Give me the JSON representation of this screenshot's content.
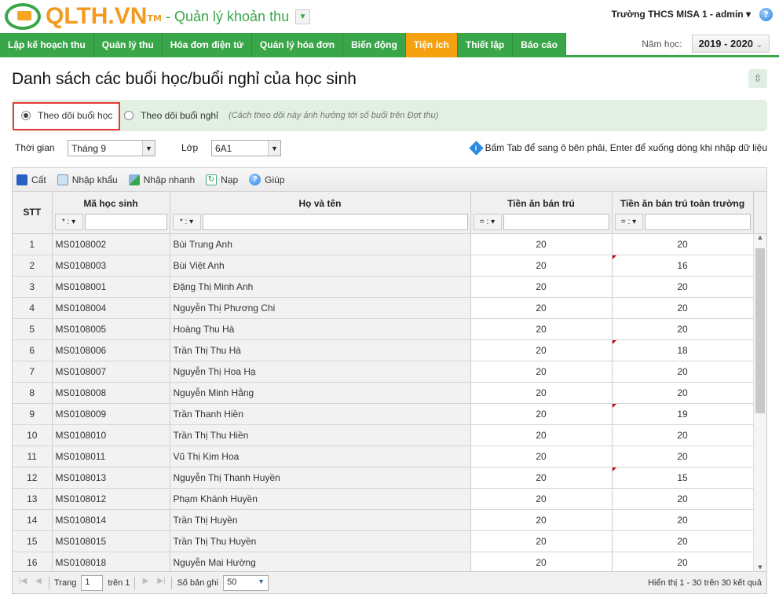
{
  "header": {
    "brand": "QLTH.VN",
    "tm": "TM",
    "module": "- Quản lý khoản thu",
    "user": "Trường THCS MISA 1 - admin ▾"
  },
  "nav": [
    {
      "label": "Lập kế hoạch thu"
    },
    {
      "label": "Quản lý thu"
    },
    {
      "label": "Hóa đơn điện tử"
    },
    {
      "label": "Quản lý hóa đơn"
    },
    {
      "label": "Biến động"
    },
    {
      "label": "Tiện ích",
      "active": true
    },
    {
      "label": "Thiết lập"
    },
    {
      "label": "Báo cáo"
    }
  ],
  "year": {
    "label": "Năm học:",
    "value": "2019 - 2020"
  },
  "page": {
    "title": "Danh sách các buổi học/buổi nghỉ của học sinh"
  },
  "mode": {
    "option1": "Theo dõi buổi học",
    "option2": "Theo dõi buổi nghỉ",
    "selected": "option1",
    "note": "(Cách theo dõi này ảnh hưởng tới số buổi trên Đợt thu)"
  },
  "filters": {
    "time_label": "Thời gian",
    "time_value": "Tháng 9",
    "class_label": "Lớp",
    "class_value": "6A1",
    "hint": "Bấm Tab để sang ô bên phải, Enter để xuống dòng khi nhập dữ liệu"
  },
  "toolbar": {
    "save": "Cất",
    "import": "Nhập khẩu",
    "quick": "Nhập nhanh",
    "reload": "Nạp",
    "help": "Giúp"
  },
  "columns": {
    "stt": "STT",
    "code": "Mã học sinh",
    "name": "Họ và tên",
    "fee": "Tiền ăn bán trú",
    "fee_all": "Tiền ăn bán trú toàn trường",
    "op_text": "* :",
    "op_num": "= :"
  },
  "rows": [
    {
      "stt": "1",
      "code": "MS0108002",
      "name": "Bùi Trung Anh",
      "fee": "20",
      "fee_all": "20"
    },
    {
      "stt": "2",
      "code": "MS0108003",
      "name": "Bùi Việt Anh",
      "fee": "20",
      "fee_all": "16",
      "flag": true
    },
    {
      "stt": "3",
      "code": "MS0108001",
      "name": "Đặng Thị Minh Anh",
      "fee": "20",
      "fee_all": "20"
    },
    {
      "stt": "4",
      "code": "MS0108004",
      "name": "Nguyễn Thị Phương Chi",
      "fee": "20",
      "fee_all": "20"
    },
    {
      "stt": "5",
      "code": "MS0108005",
      "name": "Hoàng Thu Hà",
      "fee": "20",
      "fee_all": "20"
    },
    {
      "stt": "6",
      "code": "MS0108006",
      "name": "Trần Thị Thu Hà",
      "fee": "20",
      "fee_all": "18",
      "flag": true
    },
    {
      "stt": "7",
      "code": "MS0108007",
      "name": "Nguyễn Thị Hoa Hạ",
      "fee": "20",
      "fee_all": "20"
    },
    {
      "stt": "8",
      "code": "MS0108008",
      "name": "Nguyễn Minh Hằng",
      "fee": "20",
      "fee_all": "20"
    },
    {
      "stt": "9",
      "code": "MS0108009",
      "name": "Trần Thanh Hiền",
      "fee": "20",
      "fee_all": "19",
      "flag": true
    },
    {
      "stt": "10",
      "code": "MS0108010",
      "name": "Trần Thị Thu Hiền",
      "fee": "20",
      "fee_all": "20"
    },
    {
      "stt": "11",
      "code": "MS0108011",
      "name": "Vũ Thị Kim Hoa",
      "fee": "20",
      "fee_all": "20"
    },
    {
      "stt": "12",
      "code": "MS0108013",
      "name": "Nguyễn Thị Thanh Huyền",
      "fee": "20",
      "fee_all": "15",
      "flag": true
    },
    {
      "stt": "13",
      "code": "MS0108012",
      "name": "Phạm Khánh Huyền",
      "fee": "20",
      "fee_all": "20"
    },
    {
      "stt": "14",
      "code": "MS0108014",
      "name": "Trần Thị Huyền",
      "fee": "20",
      "fee_all": "20"
    },
    {
      "stt": "15",
      "code": "MS0108015",
      "name": "Trần Thị Thu Huyền",
      "fee": "20",
      "fee_all": "20"
    },
    {
      "stt": "16",
      "code": "MS0108018",
      "name": "Nguyễn Mai Hường",
      "fee": "20",
      "fee_all": "20"
    }
  ],
  "pager": {
    "page_label": "Trang",
    "page": "1",
    "of": "trên 1",
    "size_label": "Số bản ghi",
    "size": "50",
    "summary": "Hiển thị 1 - 30 trên 30 kết quả"
  }
}
